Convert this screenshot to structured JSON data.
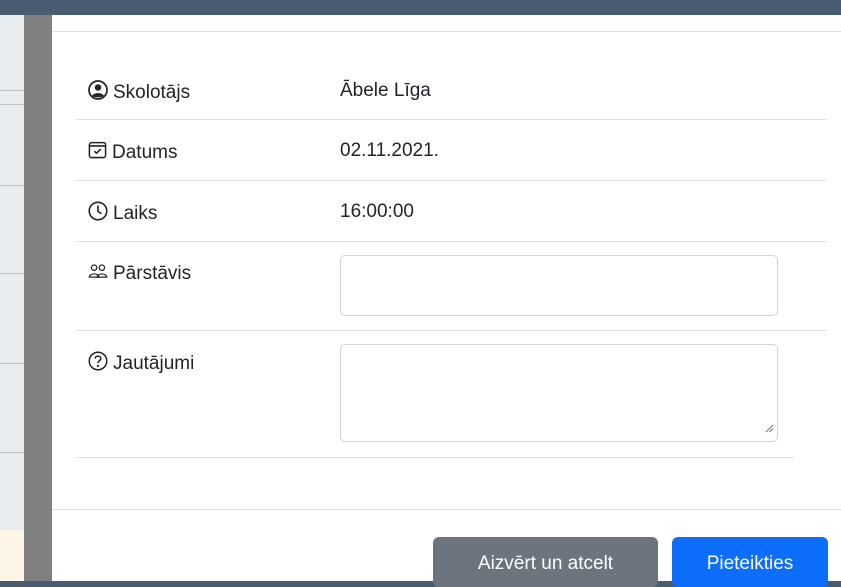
{
  "form": {
    "teacher": {
      "label": "Skolotājs",
      "value": "Ābele Līga",
      "icon": "person-circle-icon"
    },
    "date": {
      "label": "Datums",
      "value": "02.11.2021.",
      "icon": "calendar-check-icon"
    },
    "time": {
      "label": "Laiks",
      "value": "16:00:00",
      "icon": "clock-icon"
    },
    "representative": {
      "label": "Pārstāvis",
      "value": "",
      "icon": "people-icon"
    },
    "questions": {
      "label": "Jautājumi",
      "value": "",
      "icon": "question-circle-icon"
    }
  },
  "footer": {
    "cancel_label": "Aizvērt un atcelt",
    "submit_label": "Pieteikties"
  },
  "colors": {
    "primary": "#0d6efd",
    "secondary": "#6c757d",
    "backdrop": "#4a5c72"
  }
}
